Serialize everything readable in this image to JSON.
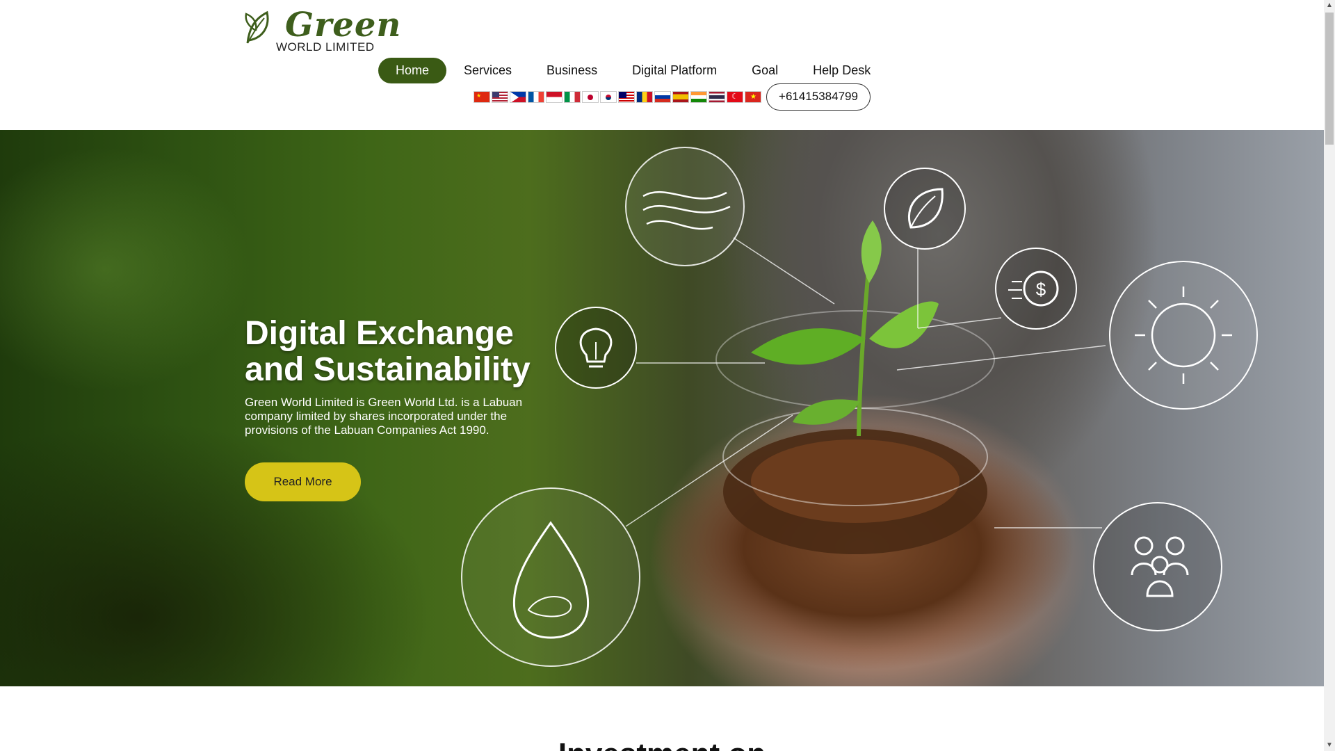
{
  "logo": {
    "word": "Green",
    "sub": "WORLD LIMITED",
    "icon": "leaf-icon",
    "color": "#3e5e1c"
  },
  "nav": {
    "items": [
      {
        "label": "Home",
        "active": true
      },
      {
        "label": "Services",
        "active": false
      },
      {
        "label": "Business",
        "active": false
      },
      {
        "label": "Digital Platform",
        "active": false
      },
      {
        "label": "Goal",
        "active": false
      },
      {
        "label": "Help Desk",
        "active": false
      }
    ],
    "active_color": "#3a5a14"
  },
  "languages": {
    "flags": [
      "china-flag-icon",
      "usa-flag-icon",
      "philippines-flag-icon",
      "france-flag-icon",
      "indonesia-flag-icon",
      "italy-flag-icon",
      "japan-flag-icon",
      "korea-flag-icon",
      "malaysia-flag-icon",
      "romania-flag-icon",
      "russia-flag-icon",
      "spain-flag-icon",
      "india-flag-icon",
      "thailand-flag-icon",
      "turkey-flag-icon",
      "vietnam-flag-icon"
    ]
  },
  "phone": {
    "label": "+61415384799"
  },
  "hero": {
    "title_line1": "Digital Exchange",
    "title_line2": "and Sustainability",
    "text": "Green World Limited is Green World Ltd. is a Labuan company limited by shares incorporated under the provisions of the Labuan Companies Act 1990.",
    "button": "Read More",
    "button_color": "#d6c417",
    "icons": [
      "wind-icon",
      "leaf-icon",
      "dollar-coin-icon",
      "lightbulb-icon",
      "sun-icon",
      "water-drop-icon",
      "people-icon"
    ]
  },
  "section": {
    "title": "Investment on"
  }
}
